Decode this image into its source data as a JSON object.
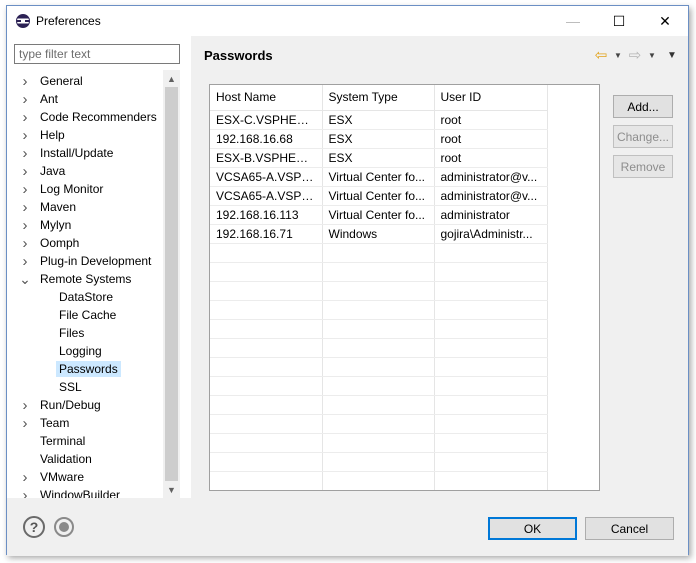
{
  "window": {
    "title": "Preferences",
    "controls": {
      "minimize": "—",
      "maximize": "☐",
      "close": "✕"
    }
  },
  "sidebar": {
    "filter_placeholder": "type filter text",
    "items": [
      {
        "label": "General",
        "expanded": false
      },
      {
        "label": "Ant",
        "expanded": false
      },
      {
        "label": "Code Recommenders",
        "expanded": false
      },
      {
        "label": "Help",
        "expanded": false
      },
      {
        "label": "Install/Update",
        "expanded": false
      },
      {
        "label": "Java",
        "expanded": false
      },
      {
        "label": "Log Monitor",
        "expanded": false
      },
      {
        "label": "Maven",
        "expanded": false
      },
      {
        "label": "Mylyn",
        "expanded": false
      },
      {
        "label": "Oomph",
        "expanded": false
      },
      {
        "label": "Plug-in Development",
        "expanded": false
      },
      {
        "label": "Remote Systems",
        "expanded": true
      },
      {
        "label": "DataStore",
        "child": true
      },
      {
        "label": "File Cache",
        "child": true
      },
      {
        "label": "Files",
        "child": true
      },
      {
        "label": "Logging",
        "child": true
      },
      {
        "label": "Passwords",
        "child": true,
        "selected": true
      },
      {
        "label": "SSL",
        "child": true
      },
      {
        "label": "Run/Debug",
        "expanded": false
      },
      {
        "label": "Team",
        "expanded": false
      },
      {
        "label": "Terminal",
        "leaf": true
      },
      {
        "label": "Validation",
        "leaf": true
      },
      {
        "label": "VMware",
        "expanded": false
      },
      {
        "label": "WindowBuilder",
        "expanded": false
      }
    ]
  },
  "page": {
    "title": "Passwords",
    "table": {
      "columns": [
        "Host Name",
        "System Type",
        "User ID"
      ],
      "rows": [
        [
          "ESX-C.VSPHERE6...",
          "ESX",
          "root"
        ],
        [
          "192.168.16.68",
          "ESX",
          "root"
        ],
        [
          "ESX-B.VSPHERE6...",
          "ESX",
          "root"
        ],
        [
          "VCSA65-A.VSPHE...",
          "Virtual Center fo...",
          "administrator@v..."
        ],
        [
          "VCSA65-A.VSPHE...",
          "Virtual Center fo...",
          "administrator@v..."
        ],
        [
          "192.168.16.113",
          "Virtual Center fo...",
          "administrator"
        ],
        [
          "192.168.16.71",
          "Windows",
          "gojira\\Administr..."
        ]
      ]
    },
    "buttons": {
      "add": "Add...",
      "change": "Change...",
      "remove": "Remove"
    }
  },
  "footer": {
    "ok": "OK",
    "cancel": "Cancel"
  },
  "colors": {
    "selection": "#cce8ff",
    "default_button_border": "#0078d7",
    "back_arrow": "#e2a21a"
  }
}
